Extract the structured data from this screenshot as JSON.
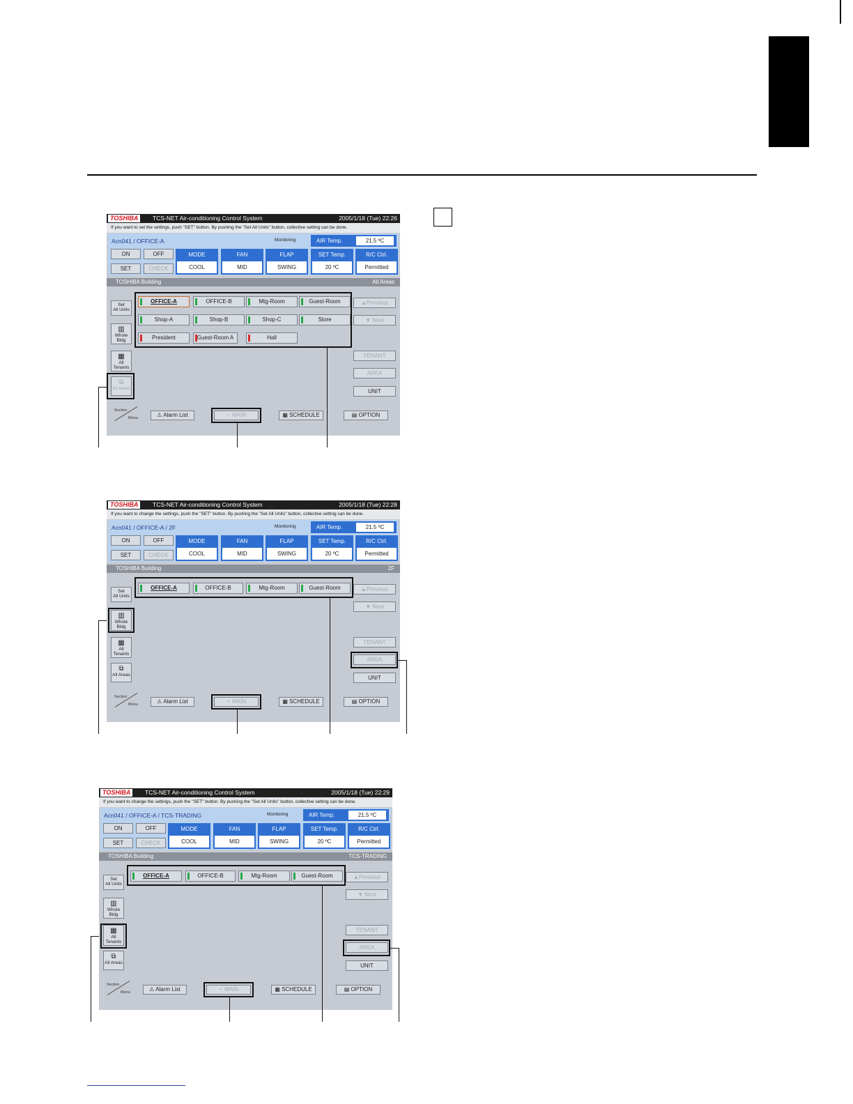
{
  "page": {},
  "common": {
    "logo": "TOSHIBA",
    "app_title": "TCS-NET Air-conditioning Control System",
    "monitoring": "Monitoring",
    "btn_on": "ON",
    "btn_off": "OFF",
    "btn_set": "SET",
    "btn_check": "CHECK",
    "air_label": "AIR Temp.",
    "air_value": "21.5 ºC",
    "h_mode": "MODE",
    "v_mode": "COOL",
    "h_fan": "FAN",
    "v_fan": "MID",
    "h_flap": "FLAP",
    "v_flap": "SWING",
    "h_set": "SET Temp.",
    "v_set": "20 ºC",
    "h_rc": "R/C Ctrl.",
    "v_rc": "Permitted",
    "building": "TOSHIBA Building",
    "set_all_1": "Set",
    "set_all_2": "All Units",
    "whole_1": "Whole",
    "whole_2": "Bldg",
    "tenants_1": "All",
    "tenants_2": "Tenants",
    "areas": "All Areas",
    "section": "Section",
    "menu": "Menu",
    "alarm": "Alarm List",
    "main": "MAIN",
    "schedule": "SCHEDULE",
    "option": "OPTION",
    "previous": "▲Previous",
    "next": "▼ Next",
    "tenant": "TENANT",
    "area": "AREA",
    "unit": "UNIT"
  },
  "screens": [
    {
      "clock": "2005/1/18 (Tue)  22:26",
      "help": "If you want to set the settings, push \"SET\" button. By pushing the \"Set All Units\" button, collective setting can be done.",
      "unit_path": "Acn041 / OFFICE-A",
      "scope": "All Areas",
      "tiles": [
        "OFFICE-A",
        "OFFICE-B",
        "Mtg-Room",
        "Guest-Room",
        "Shop-A",
        "Shop-B",
        "Shop-C",
        "Store",
        "President",
        "Guest-Room A",
        "Hall"
      ]
    },
    {
      "clock": "2005/1/18 (Tue)  22:28",
      "help": "If you want to change the settings, push the \"SET\" button. By pushing the \"Set All Units\" button, collective setting can be done.",
      "unit_path": "Acn041 / OFFICE-A / 2F",
      "scope": "2F",
      "tiles": [
        "OFFICE-A",
        "OFFICE-B",
        "Mtg-Room",
        "Guest-Room"
      ]
    },
    {
      "clock": "2005/1/18 (Tue)  22:29",
      "help": "If you want to change the settings, push the \"SET\" button. By pushing the \"Set All Units\" button, collective setting can be done.",
      "unit_path": "Acn041 / OFFICE-A / TCS-TRADING",
      "scope": "TCS-TRADING",
      "tiles": [
        "OFFICE-A",
        "OFFICE-B",
        "Mtg-Room",
        "Guest-Room"
      ]
    }
  ]
}
